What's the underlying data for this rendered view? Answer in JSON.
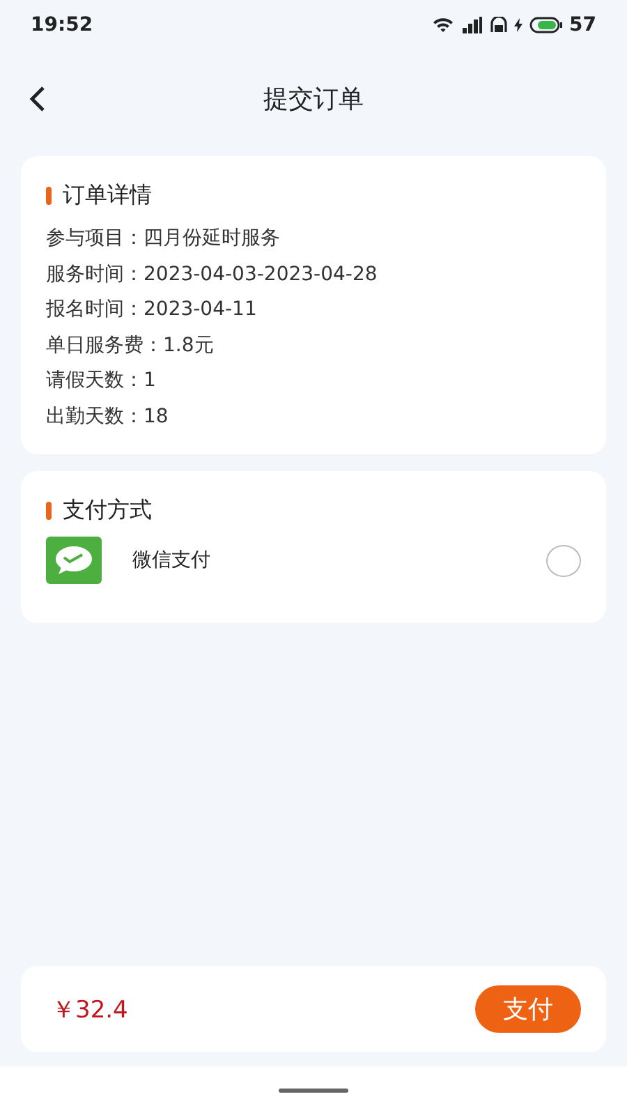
{
  "status_bar": {
    "time": "19:52",
    "battery": "57"
  },
  "header": {
    "title": "提交订单"
  },
  "order_card": {
    "title": "订单详情",
    "rows": [
      {
        "label": "参与项目：",
        "value": "四月份延时服务"
      },
      {
        "label": "服务时间：",
        "value": "2023-04-03-2023-04-28"
      },
      {
        "label": "报名时间：",
        "value": "2023-04-11"
      },
      {
        "label": "单日服务费：",
        "value": "1.8元"
      },
      {
        "label": "请假天数：",
        "value": "1"
      },
      {
        "label": "出勤天数：",
        "value": "18"
      }
    ]
  },
  "payment_card": {
    "title": "支付方式",
    "methods": [
      {
        "label": "微信支付",
        "selected": false
      }
    ]
  },
  "footer": {
    "price": "￥32.4",
    "pay_button": "支付"
  }
}
